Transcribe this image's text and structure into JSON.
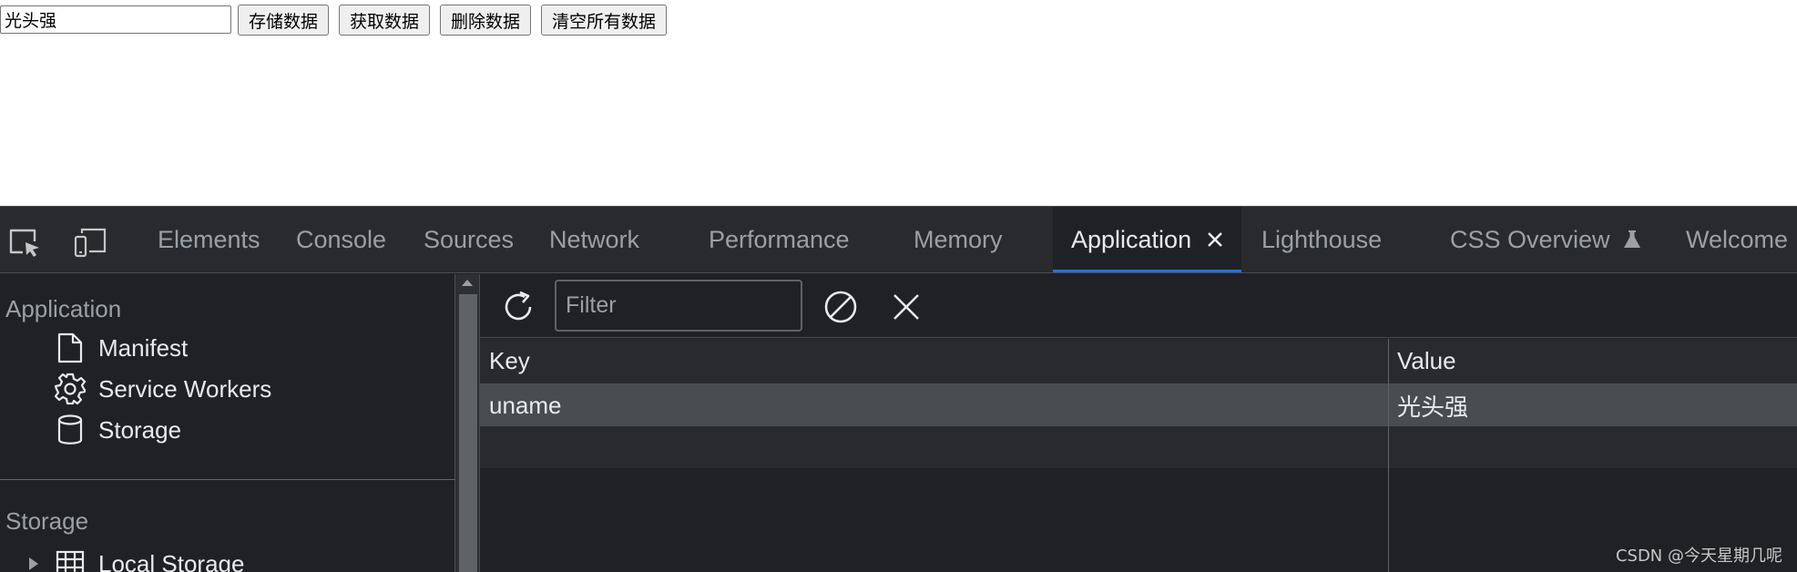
{
  "page": {
    "input_value": "光头强",
    "buttons": [
      "存储数据",
      "获取数据",
      "删除数据",
      "清空所有数据"
    ]
  },
  "devtools": {
    "tabs": [
      "Elements",
      "Console",
      "Sources",
      "Network",
      "Performance",
      "Memory",
      "Application",
      "Lighthouse",
      "CSS Overview",
      "Welcome"
    ],
    "active_tab": "Application",
    "sidebar": {
      "application_title": "Application",
      "application_items": [
        {
          "label": "Manifest",
          "icon": "document-icon"
        },
        {
          "label": "Service Workers",
          "icon": "gear-icon"
        },
        {
          "label": "Storage",
          "icon": "database-icon"
        }
      ],
      "storage_title": "Storage",
      "storage_items": [
        {
          "label": "Local Storage",
          "icon": "grid-icon"
        }
      ]
    },
    "toolbar": {
      "filter_placeholder": "Filter"
    },
    "grid": {
      "columns": [
        "Key",
        "Value"
      ],
      "rows": [
        {
          "key": "uname",
          "value": "光头强"
        }
      ]
    }
  },
  "watermark": "CSDN @今天星期几呢",
  "colors": {
    "devtools_bg": "#202124",
    "tabbar_bg": "#292a2d",
    "accent": "#1a73e8",
    "text": "#e8eaed",
    "muted_text": "#9aa0a6"
  }
}
